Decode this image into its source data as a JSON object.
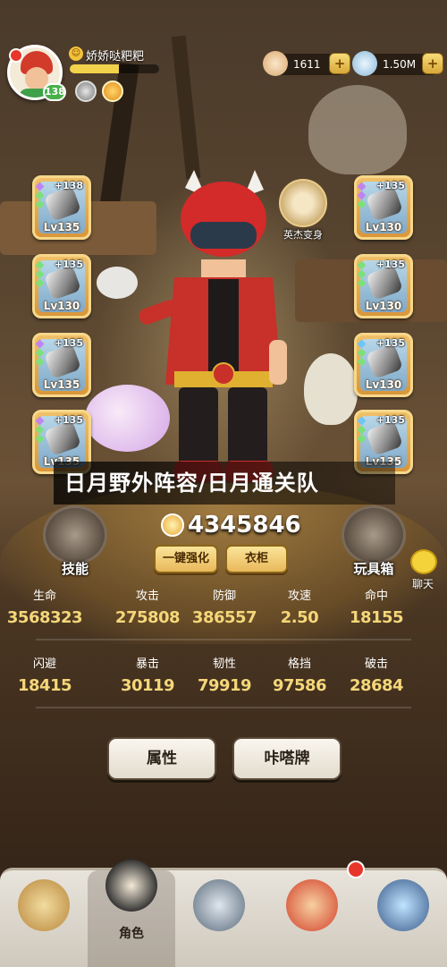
{
  "player": {
    "name": "娇娇哒粑粑",
    "level": "138",
    "xp_fraction": 0.55
  },
  "currencies": [
    {
      "name": "shell",
      "value": "1611",
      "plus": "+"
    },
    {
      "name": "crystal",
      "value": "1.50M",
      "plus": "+"
    }
  ],
  "equipment_left": [
    {
      "plus": "+138",
      "level": "Lv135"
    },
    {
      "plus": "+135",
      "level": "Lv130"
    },
    {
      "plus": "+135",
      "level": "Lv135"
    },
    {
      "plus": "+135",
      "level": "Lv135"
    }
  ],
  "equipment_right": [
    {
      "plus": "+135",
      "level": "Lv130"
    },
    {
      "plus": "+135",
      "level": "Lv130"
    },
    {
      "plus": "+135",
      "level": "Lv130"
    },
    {
      "plus": "+135",
      "level": "Lv135"
    }
  ],
  "hero_transform": {
    "label": "英杰变身"
  },
  "banner": {
    "text": "日月野外阵容/日月通关队"
  },
  "power": {
    "value": "4345846"
  },
  "actions": {
    "enhance_all": "一键强化",
    "wardrobe": "衣柜"
  },
  "side_buttons": {
    "skills": "技能",
    "toy_box": "玩具箱",
    "chat": "聊天"
  },
  "stats_row1": [
    {
      "label": "生命",
      "value": "3568323"
    },
    {
      "label": "攻击",
      "value": "275808"
    },
    {
      "label": "防御",
      "value": "386557"
    },
    {
      "label": "攻速",
      "value": "2.50"
    },
    {
      "label": "命中",
      "value": "18155"
    }
  ],
  "stats_row2": [
    {
      "label": "闪避",
      "value": "18415"
    },
    {
      "label": "暴击",
      "value": "30119"
    },
    {
      "label": "韧性",
      "value": "79919"
    },
    {
      "label": "格挡",
      "value": "97586"
    },
    {
      "label": "破击",
      "value": "28684"
    }
  ],
  "tabs": {
    "attributes": "属性",
    "kadapai": "咔嗒牌"
  },
  "bottom_nav": [
    {
      "name": "pet",
      "label": ""
    },
    {
      "name": "character",
      "label": "角色"
    },
    {
      "name": "weapon",
      "label": ""
    },
    {
      "name": "companion",
      "label": ""
    },
    {
      "name": "shop",
      "label": ""
    }
  ],
  "colors": {
    "stat_value": "#f5d77a",
    "slot_frame": "#f0c068",
    "gold_button": "#fbe49a",
    "gem_purple": "#c084f0",
    "gem_green": "#7de07a",
    "gem_blue": "#6ec6f5"
  }
}
